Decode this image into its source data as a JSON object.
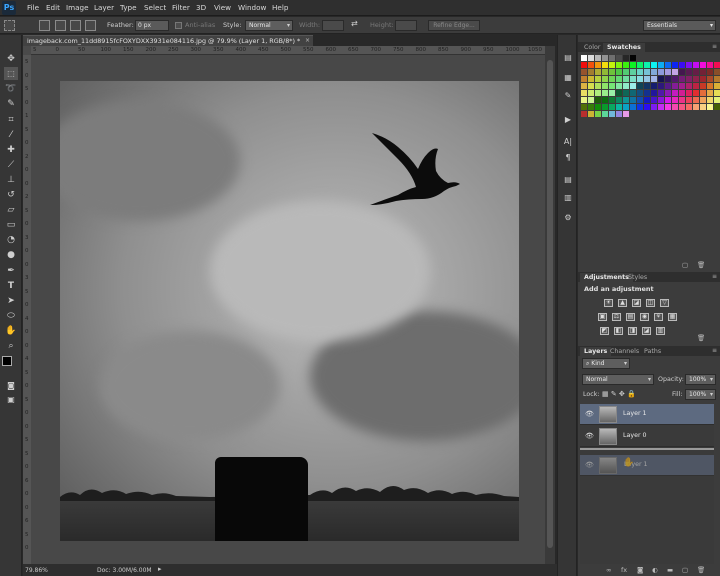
{
  "menu": {
    "logo": "Ps",
    "items": [
      "File",
      "Edit",
      "Image",
      "Layer",
      "Type",
      "Select",
      "Filter",
      "3D",
      "View",
      "Window",
      "Help"
    ]
  },
  "options": {
    "feather_label": "Feather:",
    "feather_value": "0 px",
    "antialias_label": "Anti-alias",
    "style_label": "Style:",
    "style_value": "Normal",
    "width_label": "Width:",
    "height_label": "Height:",
    "refine_edge": "Refine Edge...",
    "workspace": "Essentials"
  },
  "document": {
    "tab_title": "imageback.com_11dd8915fcFOXYDXX3931e084116.jpg @ 79.9% (Layer 1, RGB/8*) *",
    "close_glyph": "×",
    "ruler_top": [
      "5",
      "0",
      "50",
      "100",
      "150",
      "200",
      "250",
      "300",
      "350",
      "400",
      "450",
      "500",
      "550",
      "600",
      "650",
      "700",
      "750",
      "800",
      "850",
      "900",
      "950",
      "1000",
      "1050"
    ],
    "ruler_left": [
      "5",
      "0",
      "5",
      "0",
      "1",
      "5",
      "0",
      "2",
      "0",
      "0",
      "2",
      "5",
      "0",
      "3",
      "0",
      "0",
      "3",
      "5",
      "0",
      "4",
      "0",
      "0",
      "4",
      "5",
      "0",
      "5",
      "0",
      "0",
      "5",
      "5",
      "0",
      "6",
      "0",
      "0",
      "6",
      "5",
      "0"
    ]
  },
  "status": {
    "zoom": "79.86%",
    "doc": "Doc: 3.00M/6.00M"
  },
  "panels": {
    "color_tab": "Color",
    "swatches_tab": "Swatches",
    "adjustments_tab": "Adjustments",
    "styles_tab": "Styles",
    "add_adjustment": "Add an adjustment",
    "layers_tab": "Layers",
    "channels_tab": "Channels",
    "paths_tab": "Paths",
    "kind_label": "Kind",
    "blend_mode": "Normal",
    "opacity_label": "Opacity:",
    "opacity_value": "100%",
    "lock_label": "Lock:",
    "fill_label": "Fill:",
    "fill_value": "100%",
    "layers": [
      {
        "name": "Layer 1",
        "selected": true
      },
      {
        "name": "Layer 0",
        "selected": false
      }
    ],
    "drag_ghost_name": "Layer 1"
  },
  "colors": {
    "selection": "#5d6a80",
    "accent": "#3aa6ff"
  }
}
